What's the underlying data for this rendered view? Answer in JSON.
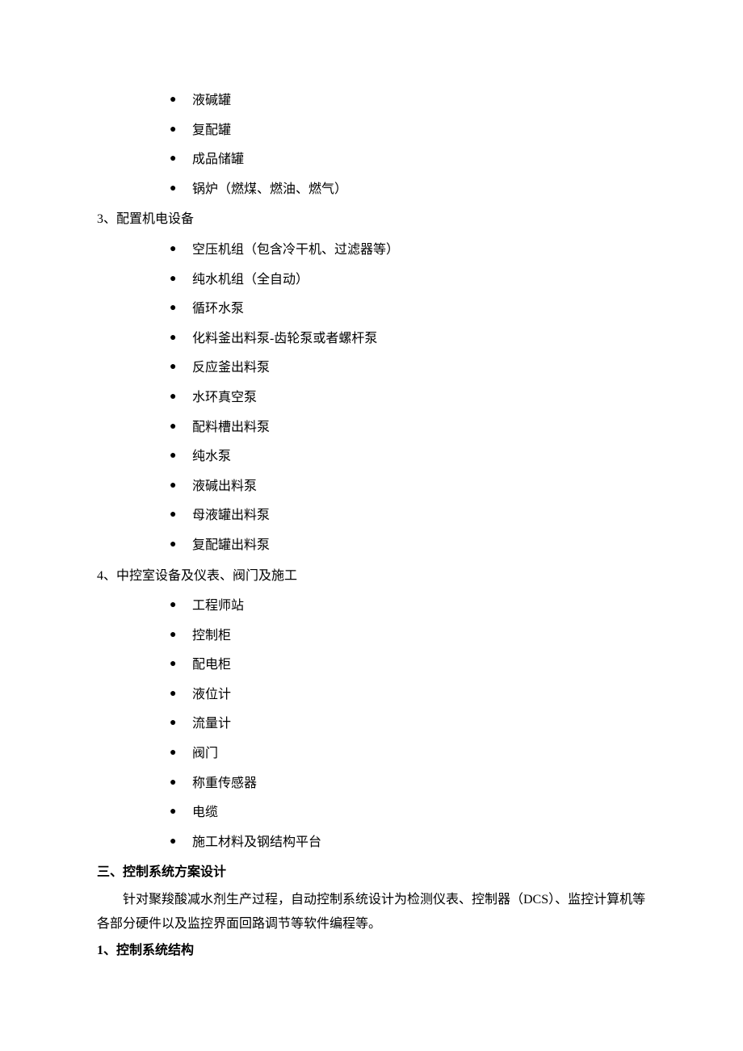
{
  "list1": {
    "items": [
      "液碱罐",
      "复配罐",
      "成品储罐",
      "锅炉（燃煤、燃油、燃气）"
    ]
  },
  "section3": {
    "title": "3、配置机电设备",
    "items": [
      "空压机组（包含冷干机、过滤器等）",
      "纯水机组（全自动）",
      "循环水泵",
      "化料釜出料泵-齿轮泵或者螺杆泵",
      "反应釜出料泵",
      "水环真空泵",
      "配料槽出料泵",
      "纯水泵",
      "液碱出料泵",
      "母液罐出料泵",
      "复配罐出料泵"
    ]
  },
  "section4": {
    "title": "4、中控室设备及仪表、阀门及施工",
    "items": [
      "工程师站",
      "控制柜",
      "配电柜",
      "液位计",
      "流量计",
      "阀门",
      "称重传感器",
      "电缆",
      "施工材料及钢结构平台"
    ]
  },
  "sectionThree": {
    "title": "三、控制系统方案设计",
    "paragraph": "针对聚羧酸减水剂生产过程，自动控制系统设计为检测仪表、控制器（DCS）、监控计算机等各部分硬件以及监控界面回路调节等软件编程等。"
  },
  "subSection1": {
    "title": "1、控制系统结构"
  }
}
